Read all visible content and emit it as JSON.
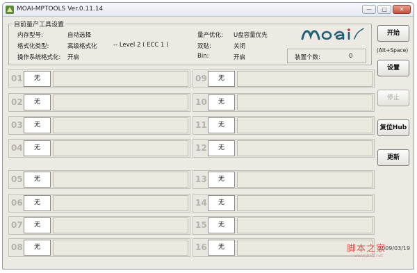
{
  "window": {
    "title": "MOAI-MPTOOLS Ver.0.11.14"
  },
  "settings": {
    "legend": "目前量产工具设置",
    "memory_type_label": "内存型号:",
    "memory_type_value": "自动选择",
    "format_type_label": "格式化类型:",
    "format_type_value": "高级格式化",
    "format_level": "-- Level 2 ( ECC 1 )",
    "os_format_label": "操作系统格式化:",
    "os_format_value": "开启",
    "optimize_label": "量产优化:",
    "optimize_value": "U盘容量优先",
    "double_label": "双贴:",
    "double_value": "关闭",
    "bin_label": "Bin:",
    "bin_value": "开启"
  },
  "logo": {
    "text": "Moai"
  },
  "device_count": {
    "label": "装置个数:",
    "value": "0"
  },
  "ports": [
    {
      "num": "01",
      "status": "无"
    },
    {
      "num": "02",
      "status": "无"
    },
    {
      "num": "03",
      "status": "无"
    },
    {
      "num": "04",
      "status": "无"
    },
    {
      "num": "05",
      "status": "无"
    },
    {
      "num": "06",
      "status": "无"
    },
    {
      "num": "07",
      "status": "无"
    },
    {
      "num": "08",
      "status": "无"
    },
    {
      "num": "09",
      "status": "无"
    },
    {
      "num": "10",
      "status": "无"
    },
    {
      "num": "11",
      "status": "无"
    },
    {
      "num": "12",
      "status": "无"
    },
    {
      "num": "13",
      "status": "无"
    },
    {
      "num": "14",
      "status": "无"
    },
    {
      "num": "15",
      "status": "无"
    },
    {
      "num": "16",
      "status": "无"
    }
  ],
  "buttons": {
    "start": "开始",
    "start_shortcut": "(Alt+Space)",
    "settings": "设置",
    "stop": "停止",
    "reset_hub": "复位Hub",
    "update": "更新"
  },
  "footer": {
    "date_fragment": "2009/03/19",
    "watermark": "脚本之家",
    "watermark_url": "www.jb51.net"
  }
}
